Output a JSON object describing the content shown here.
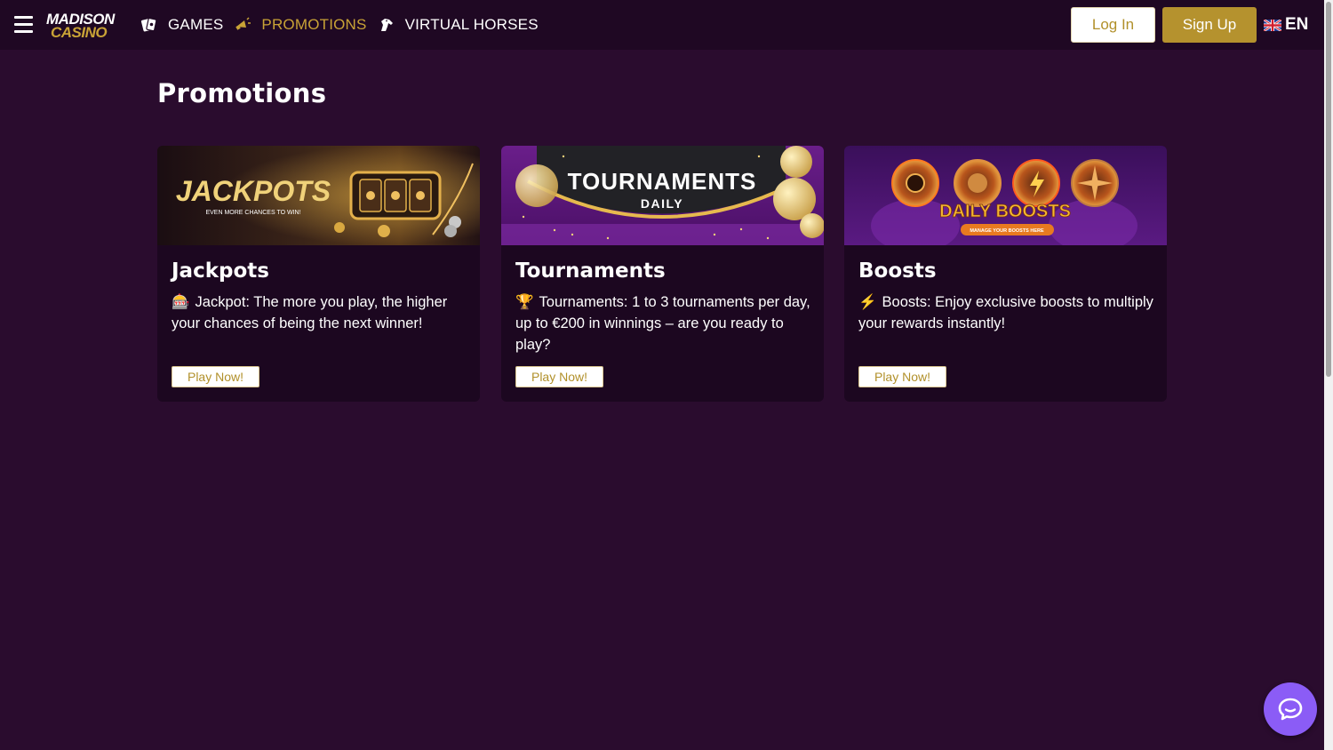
{
  "brand": {
    "line1": "MADISON",
    "line2": "CASINO"
  },
  "nav": [
    {
      "label": "GAMES",
      "icon": "cards-icon",
      "active": false
    },
    {
      "label": "PROMOTIONS",
      "icon": "megaphone-icon",
      "active": true
    },
    {
      "label": "VIRTUAL HORSES",
      "icon": "horse-icon",
      "active": false
    }
  ],
  "auth": {
    "login_label": "Log In",
    "signup_label": "Sign Up"
  },
  "language": {
    "code": "EN",
    "flag": "uk-flag-icon"
  },
  "page": {
    "title": "Promotions"
  },
  "cards": [
    {
      "title": "Jackpots",
      "emoji": "🎰",
      "description": "Jackpot: The more you play, the higher your chances of being the next winner!",
      "button": "Play Now!",
      "banner_title": "JACKPOTS",
      "banner_subtitle": "EVEN MORE CHANCES TO WIN!"
    },
    {
      "title": "Tournaments",
      "emoji": "🏆",
      "description": "Tournaments: 1 to 3 tournaments per day, up to €200 in winnings – are you ready to play?",
      "button": "Play Now!",
      "banner_title": "TOURNAMENTS",
      "banner_subtitle": "DAILY"
    },
    {
      "title": "Boosts",
      "emoji": "⚡",
      "description": "Boosts: Enjoy exclusive boosts to multiply your rewards instantly!",
      "button": "Play Now!",
      "banner_title": "DAILY BOOSTS",
      "banner_subtitle": "MANAGE YOUR BOOSTS HERE"
    }
  ],
  "colors": {
    "background": "#2a0c2e",
    "header": "#1f0823",
    "card": "#1c0720",
    "gold": "#c9a336",
    "chat": "#8b5cf6"
  },
  "chat": {
    "icon": "chat-bubble-icon"
  }
}
